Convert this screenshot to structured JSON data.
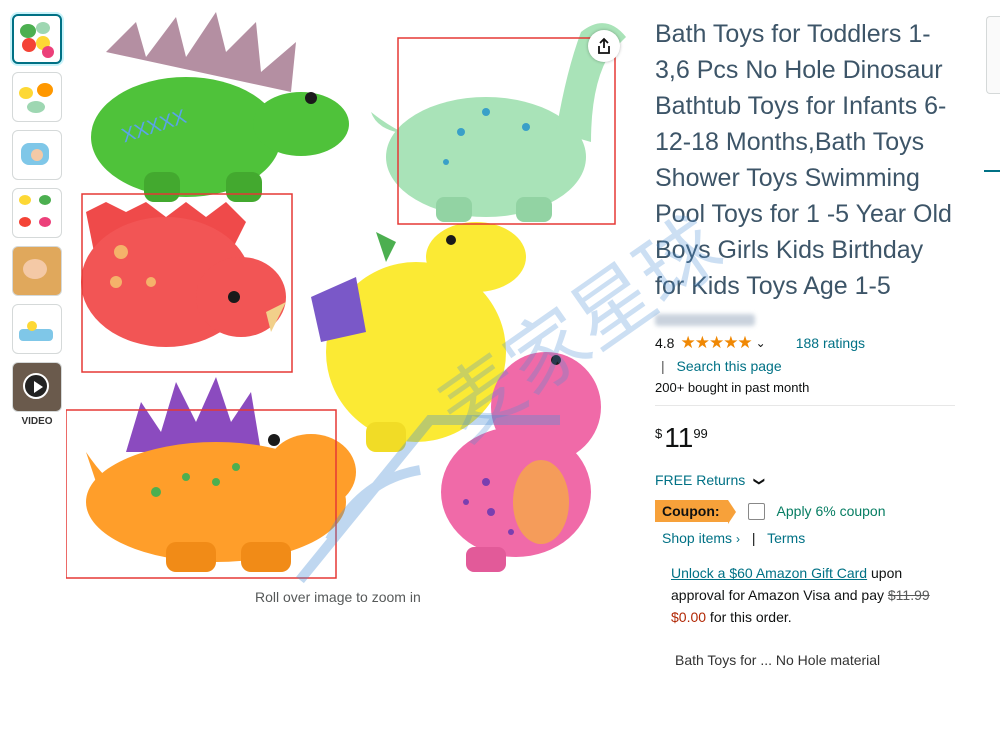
{
  "product": {
    "title": "Bath Toys for Toddlers 1-3,6 Pcs No Hole Dinosaur Bathtub Toys for Infants 6-12-18 Months,Bath Toys Shower Toys Swimming Pool Toys for 1 -5 Year Old Boys Girls Kids Birthday for Kids Toys Age 1-5",
    "rating_value": "4.8",
    "stars": "★★★★★",
    "ratings_count": "188 ratings",
    "search_sep": "|",
    "search_link": "Search this page",
    "bought": "200+ bought in past month"
  },
  "price": {
    "symbol": "$",
    "whole": "11",
    "fraction": "99"
  },
  "returns": {
    "label": "FREE Returns",
    "chevron": "❯"
  },
  "coupon": {
    "badge": "Coupon:",
    "text": "Apply 6% coupon",
    "shop_items": "Shop items",
    "shop_chevron": "›",
    "sep": "|",
    "terms": "Terms"
  },
  "gift_card": {
    "link": "Unlock a $60 Amazon Gift Card",
    "text1": " upon approval for Amazon Visa and pay ",
    "old_price": "$11.99",
    "new_price": "$0.00",
    "text2": " for this order."
  },
  "truncated_line": "Bath Toys for ... No Hole material",
  "gallery": {
    "video_label": "VIDEO",
    "zoom_hint": "Roll over image to zoom in"
  },
  "icons": {
    "share": "share-icon",
    "play": "play-icon",
    "dropdown": "chevron-down-icon"
  },
  "colors": {
    "link": "#007185",
    "star": "#f08804",
    "coupon_badge": "#f7a13a",
    "coupon_text": "#067D62",
    "price_red": "#B12704",
    "annotation_box": "#e53935"
  }
}
